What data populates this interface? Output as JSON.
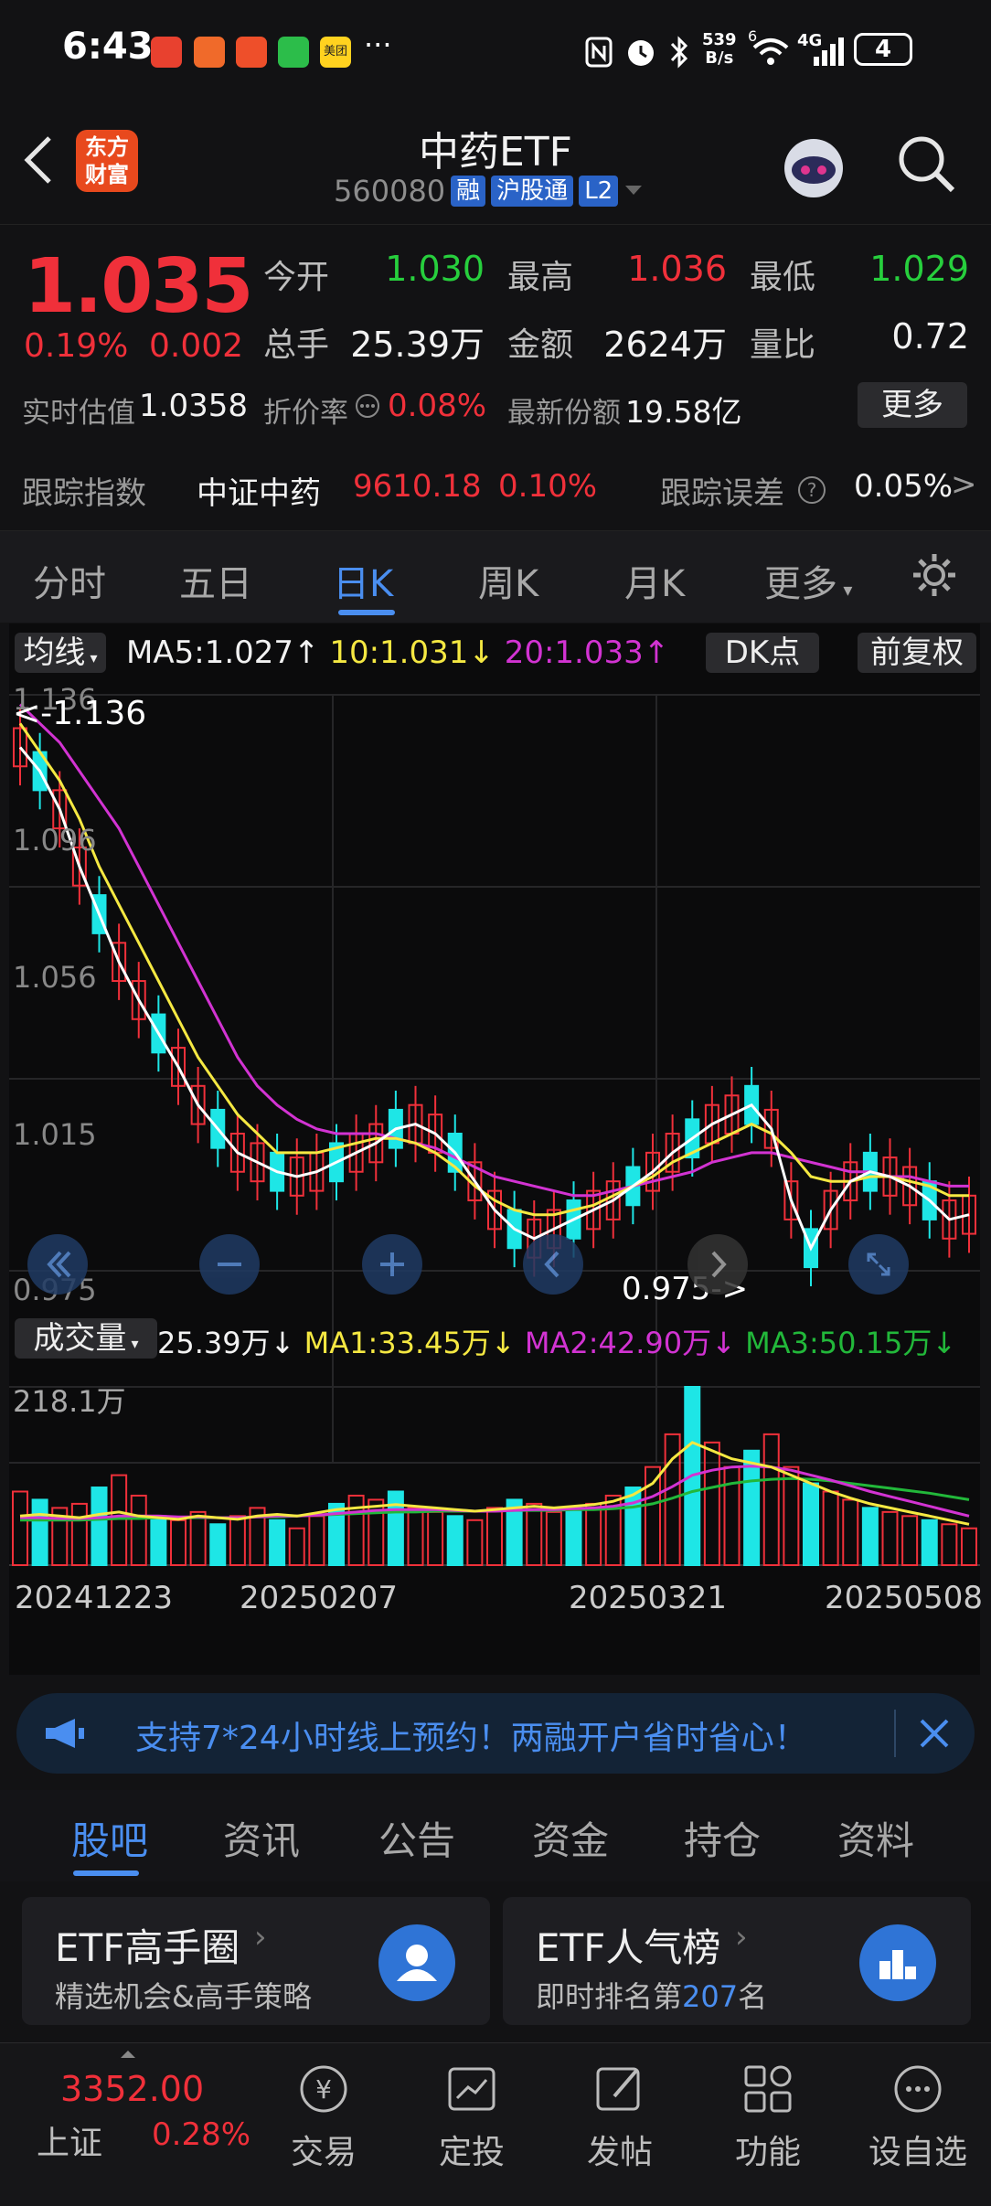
{
  "status": {
    "time": "6:43",
    "net_speed_top": "539",
    "net_speed_bottom": "B/s",
    "battery": "4",
    "net_type": "4G",
    "sim": "6",
    "overflow": "···",
    "app_badge": "美团"
  },
  "header": {
    "title": "中药ETF",
    "code": "560080",
    "tags": [
      "融",
      "沪股通",
      "L2"
    ],
    "logo_line1": "东方",
    "logo_line2": "财富"
  },
  "quote": {
    "price": "1.035",
    "change_pct": "0.19%",
    "change": "0.002",
    "open_label": "今开",
    "open": "1.030",
    "high_label": "最高",
    "high": "1.036",
    "low_label": "最低",
    "low": "1.029",
    "volume_label": "总手",
    "volume": "25.39万",
    "amount_label": "金额",
    "amount": "2624万",
    "vol_ratio_label": "量比",
    "vol_ratio": "0.72",
    "iopv_label": "实时估值",
    "iopv": "1.0358",
    "premium_label": "折价率",
    "premium": "0.08%",
    "shares_label": "最新份额",
    "shares": "19.58亿",
    "more_label": "更多"
  },
  "tracking": {
    "label": "跟踪指数",
    "index_name": "中证中药",
    "index_value": "9610.18",
    "index_pct": "0.10%",
    "error_label": "跟踪误差",
    "error_value": "0.05%",
    "arrow": ">"
  },
  "ktabs": [
    "分时",
    "五日",
    "日K",
    "周K",
    "月K",
    "更多"
  ],
  "chart": {
    "ma_label": "均线",
    "ma5": "MA5:1.027",
    "ma10": "10:1.031",
    "ma20": "20:1.033",
    "dk_label": "DK点",
    "fq_label": "前复权",
    "price_ticks": [
      "1.136",
      "1.096",
      "1.056",
      "1.015",
      "0.975"
    ],
    "max_marker": "<-1.136",
    "min_marker": "0.975->",
    "vol_label": "成交量",
    "vol_now": "25.39万",
    "vol_ma1": "MA1:33.45万",
    "vol_ma2": "MA2:42.90万",
    "vol_ma3": "MA3:50.15万",
    "vol_max": "218.1万",
    "dates": [
      "20241223",
      "20250207",
      "20250321",
      "20250508"
    ],
    "colors": {
      "up": "#f0303a",
      "down": "#1ee6e6",
      "ma5": "#ffffff",
      "ma10": "#f5e842",
      "ma20": "#d233d2",
      "vol_ma3": "#22b83a"
    }
  },
  "chart_data": {
    "type": "candlestick",
    "ylim": [
      0.975,
      1.136
    ],
    "ma5": [
      1.125,
      1.12,
      1.112,
      1.1,
      1.09,
      1.08,
      1.072,
      1.065,
      1.058,
      1.05,
      1.045,
      1.04,
      1.038,
      1.036,
      1.035,
      1.036,
      1.038,
      1.04,
      1.042,
      1.045,
      1.046,
      1.044,
      1.04,
      1.034,
      1.028,
      1.024,
      1.022,
      1.024,
      1.026,
      1.028,
      1.03,
      1.033,
      1.036,
      1.04,
      1.043,
      1.046,
      1.048,
      1.05,
      1.045,
      1.03,
      1.02,
      1.028,
      1.034,
      1.036,
      1.035,
      1.033,
      1.03,
      1.026,
      1.027
    ],
    "ma10": [
      1.13,
      1.124,
      1.118,
      1.11,
      1.1,
      1.092,
      1.084,
      1.076,
      1.068,
      1.06,
      1.054,
      1.048,
      1.044,
      1.04,
      1.04,
      1.04,
      1.041,
      1.042,
      1.043,
      1.043,
      1.042,
      1.04,
      1.037,
      1.033,
      1.03,
      1.028,
      1.027,
      1.027,
      1.028,
      1.029,
      1.031,
      1.033,
      1.035,
      1.038,
      1.04,
      1.042,
      1.044,
      1.046,
      1.044,
      1.04,
      1.035,
      1.034,
      1.034,
      1.035,
      1.035,
      1.034,
      1.033,
      1.031,
      1.031
    ],
    "ma20": [
      1.134,
      1.13,
      1.126,
      1.12,
      1.114,
      1.108,
      1.1,
      1.092,
      1.084,
      1.076,
      1.068,
      1.06,
      1.054,
      1.05,
      1.047,
      1.045,
      1.044,
      1.044,
      1.044,
      1.043,
      1.042,
      1.041,
      1.039,
      1.037,
      1.035,
      1.034,
      1.033,
      1.032,
      1.031,
      1.031,
      1.032,
      1.033,
      1.034,
      1.035,
      1.036,
      1.038,
      1.039,
      1.04,
      1.04,
      1.039,
      1.038,
      1.037,
      1.036,
      1.036,
      1.035,
      1.035,
      1.034,
      1.033,
      1.033
    ],
    "volume": [
      90,
      80,
      70,
      75,
      95,
      110,
      85,
      60,
      55,
      65,
      50,
      60,
      70,
      55,
      45,
      60,
      75,
      85,
      80,
      90,
      70,
      65,
      60,
      55,
      70,
      80,
      75,
      65,
      70,
      75,
      85,
      95,
      120,
      160,
      218,
      150,
      120,
      140,
      160,
      120,
      100,
      90,
      80,
      70,
      65,
      60,
      55,
      50,
      45
    ],
    "vol_ma1": [
      60,
      62,
      60,
      58,
      62,
      65,
      60,
      58,
      56,
      60,
      58,
      56,
      60,
      62,
      60,
      64,
      68,
      70,
      72,
      74,
      72,
      70,
      68,
      66,
      68,
      70,
      72,
      70,
      72,
      74,
      78,
      86,
      100,
      130,
      150,
      140,
      130,
      125,
      120,
      110,
      100,
      90,
      82,
      75,
      70,
      65,
      60,
      55,
      50
    ],
    "vol_ma2": [
      58,
      58,
      57,
      57,
      58,
      60,
      60,
      60,
      59,
      59,
      58,
      58,
      59,
      60,
      60,
      61,
      63,
      65,
      67,
      68,
      68,
      68,
      67,
      66,
      66,
      67,
      68,
      68,
      69,
      70,
      72,
      76,
      84,
      96,
      110,
      116,
      120,
      121,
      120,
      116,
      110,
      104,
      97,
      90,
      84,
      78,
      72,
      66,
      60
    ],
    "vol_ma3": [
      55,
      55,
      55,
      55,
      56,
      57,
      57,
      58,
      58,
      58,
      58,
      58,
      59,
      59,
      60,
      61,
      62,
      63,
      64,
      65,
      65,
      66,
      66,
      66,
      66,
      67,
      67,
      67,
      68,
      68,
      69,
      71,
      75,
      82,
      90,
      95,
      100,
      103,
      105,
      106,
      105,
      103,
      100,
      97,
      94,
      91,
      88,
      84,
      80
    ]
  },
  "banner": {
    "text": "支持7*24小时线上预约！两融开户省时省心！"
  },
  "btabs": [
    "股吧",
    "资讯",
    "公告",
    "资金",
    "持仓",
    "资料"
  ],
  "cards": [
    {
      "title": "ETF高手圈",
      "sub": "精选机会&高手策略"
    },
    {
      "title": "ETF人气榜",
      "sub_pre": "即时排名第",
      "rank": "207",
      "sub_post": "名"
    }
  ],
  "nav": {
    "index_value": "3352.00",
    "index_name": "上证",
    "index_pct": "0.28%",
    "items": [
      "交易",
      "定投",
      "发帖",
      "功能",
      "设自选"
    ]
  }
}
